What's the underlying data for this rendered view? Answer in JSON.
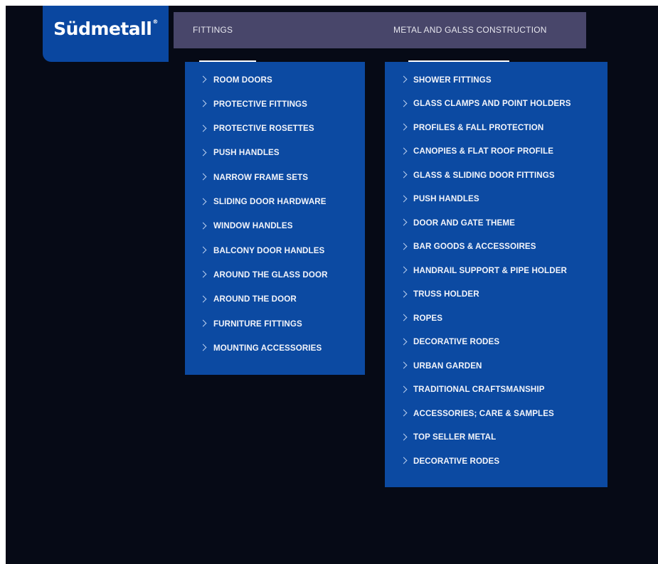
{
  "brand": {
    "name": "Südmetall",
    "mark": "®"
  },
  "nav": {
    "fittings": "FITTINGS",
    "metal": "METAL AND GALSS CONSTRUCTION"
  },
  "menus": {
    "fittings": [
      "ROOM DOORS",
      "PROTECTIVE FITTINGS",
      "PROTECTIVE ROSETTES",
      "PUSH HANDLES",
      "NARROW FRAME SETS",
      "SLIDING DOOR HARDWARE",
      "WINDOW HANDLES",
      "BALCONY DOOR HANDLES",
      "AROUND THE GLASS DOOR",
      "AROUND THE DOOR",
      "FURNITURE FITTINGS",
      "MOUNTING ACCESSORIES"
    ],
    "metal": [
      "SHOWER FITTINGS",
      "GLASS CLAMPS AND POINT HOLDERS",
      "PROFILES & FALL PROTECTION",
      "CANOPIES & FLAT ROOF PROFILE",
      "GLASS & SLIDING DOOR FITTINGS",
      "PUSH HANDLES",
      "DOOR AND GATE THEME",
      "BAR GOODS & ACCESSOIRES",
      "HANDRAIL SUPPORT & PIPE HOLDER",
      "TRUSS HOLDER",
      "ROPES",
      "DECORATIVE RODES",
      "URBAN GARDEN",
      "TRADITIONAL CRAFTSMANSHIP",
      "ACCESSORIES; CARE & SAMPLES",
      "TOP SELLER METAL",
      "DECORATIVE RODES"
    ]
  },
  "colors": {
    "background": "#060a16",
    "menu": "#0c4aa2",
    "navbar": "#48466a",
    "logo": "#0a47a0"
  },
  "icons": {
    "menu_item": "chevron-right-icon"
  }
}
